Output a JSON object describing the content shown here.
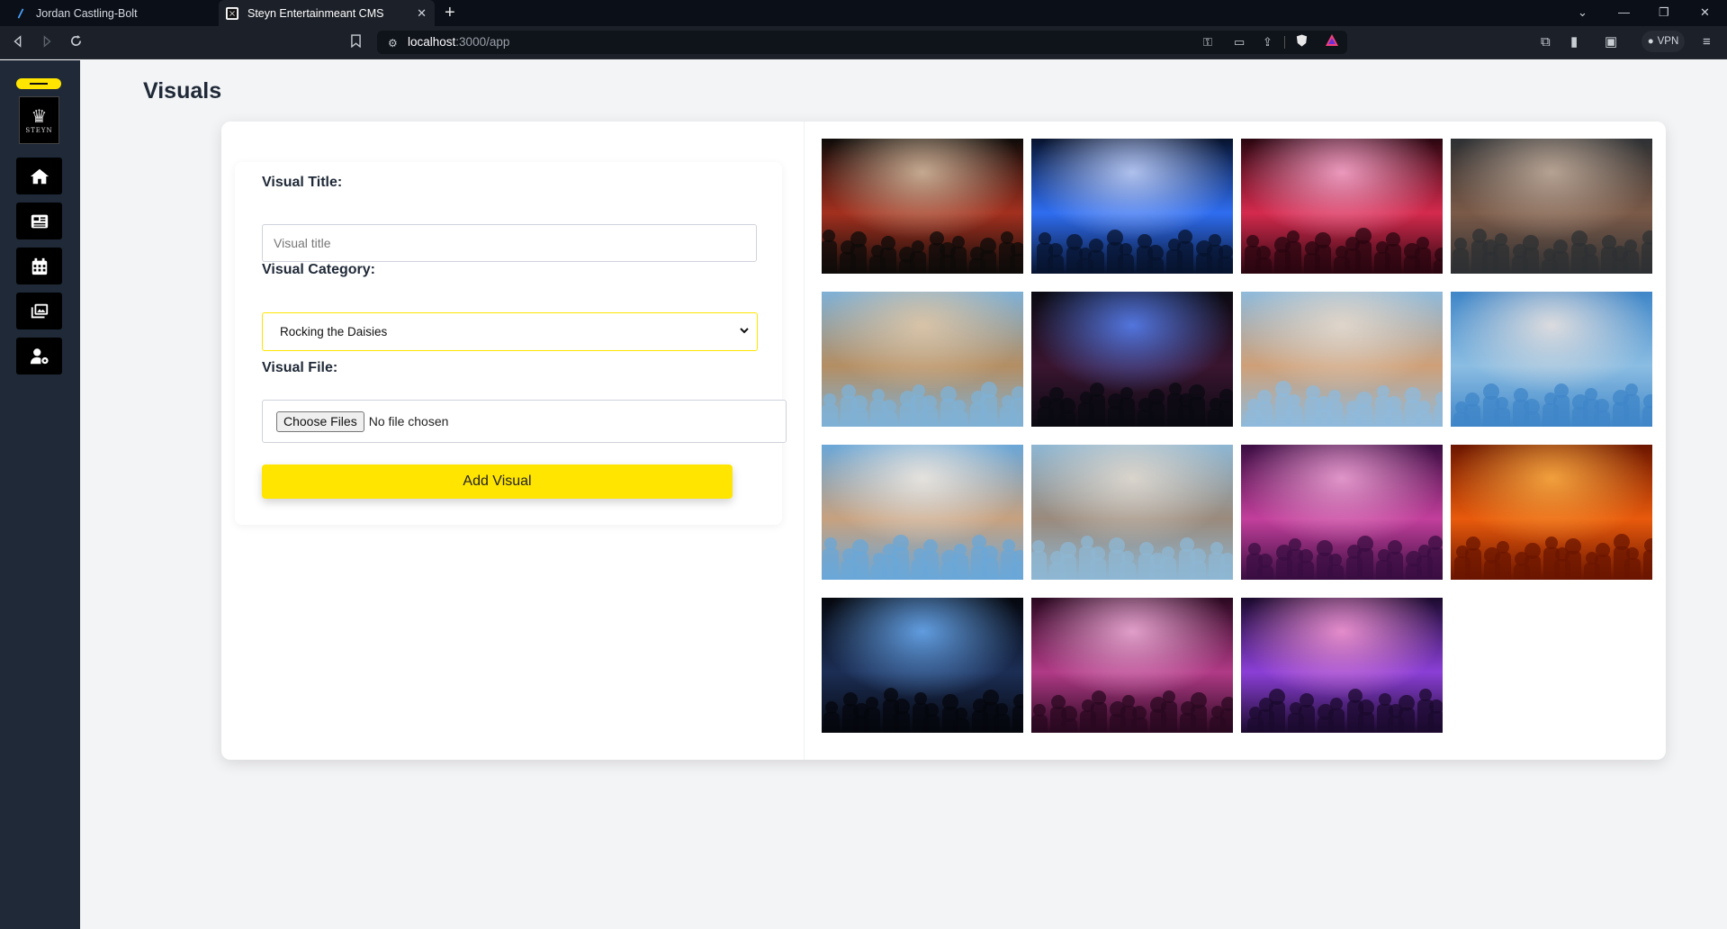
{
  "browser": {
    "tabs": [
      {
        "title": "Jordan Castling-Bolt",
        "active": false
      },
      {
        "title": "Steyn Entertainmeant CMS",
        "active": true
      }
    ],
    "url_host": "localhost",
    "url_path": ":3000/app",
    "vpn_label": "VPN"
  },
  "sidebar": {
    "logo_text": "STEYN",
    "items": [
      {
        "name": "home",
        "icon": "home-icon"
      },
      {
        "name": "articles",
        "icon": "newspaper-icon"
      },
      {
        "name": "events",
        "icon": "calendar-icon"
      },
      {
        "name": "visuals",
        "icon": "images-icon"
      },
      {
        "name": "users",
        "icon": "user-gear-icon"
      }
    ]
  },
  "page": {
    "title": "Visuals"
  },
  "form": {
    "title_label": "Visual Title:",
    "title_placeholder": "Visual title",
    "title_value": "",
    "category_label": "Visual Category:",
    "category_selected": "Rocking the Daisies",
    "file_label": "Visual File:",
    "choose_button": "Choose Files",
    "file_status": "No file chosen",
    "submit_label": "Add Visual"
  },
  "gallery": {
    "images": [
      {
        "subject": "performer-on-stage-night-crowd",
        "colors": [
          "#0e0b09",
          "#a3301f",
          "#d9c2a6"
        ]
      },
      {
        "subject": "laser-light-show-blue",
        "colors": [
          "#07132e",
          "#2f6df0",
          "#c9d8ff"
        ]
      },
      {
        "subject": "laser-light-show-red",
        "colors": [
          "#2a0610",
          "#d42a4d",
          "#ffb0d6"
        ]
      },
      {
        "subject": "friends-in-crowd-closeup",
        "colors": [
          "#2d3033",
          "#7b5a48",
          "#c8b3a2"
        ]
      },
      {
        "subject": "daytime-festival-crowd",
        "colors": [
          "#7fb1d6",
          "#b48e63",
          "#e3c9a8"
        ]
      },
      {
        "subject": "main-stage-night-crowd",
        "colors": [
          "#0a0a12",
          "#3a1530",
          "#5b87ff"
        ]
      },
      {
        "subject": "dancing-near-bar",
        "colors": [
          "#8fbadb",
          "#cfa078",
          "#e8dccf"
        ]
      },
      {
        "subject": "dancer-with-parasol",
        "colors": [
          "#3f86c8",
          "#8bbde2",
          "#f1e6e0"
        ]
      },
      {
        "subject": "arms-up-sunny-crowd",
        "colors": [
          "#6aa7d8",
          "#c7a17f",
          "#f3ede6"
        ]
      },
      {
        "subject": "friends-with-bucket-hats",
        "colors": [
          "#8eb7d3",
          "#9a8a7c",
          "#e6ddd2"
        ]
      },
      {
        "subject": "pink-lit-crowd-laughing",
        "colors": [
          "#3a0d42",
          "#c23f9b",
          "#f2a9d9"
        ]
      },
      {
        "subject": "singer-orange-stage",
        "colors": [
          "#6b1500",
          "#e85a0c",
          "#ffb347"
        ]
      },
      {
        "subject": "rapper-blue-spotlights",
        "colors": [
          "#05070d",
          "#1c2e55",
          "#6fb4ff"
        ]
      },
      {
        "subject": "pink-crowd-hands-up",
        "colors": [
          "#2a0820",
          "#b03a86",
          "#f5b5df"
        ]
      },
      {
        "subject": "silhouette-neon-frame",
        "colors": [
          "#1b0a2e",
          "#8b3fd6",
          "#ff9fd9"
        ]
      }
    ]
  }
}
